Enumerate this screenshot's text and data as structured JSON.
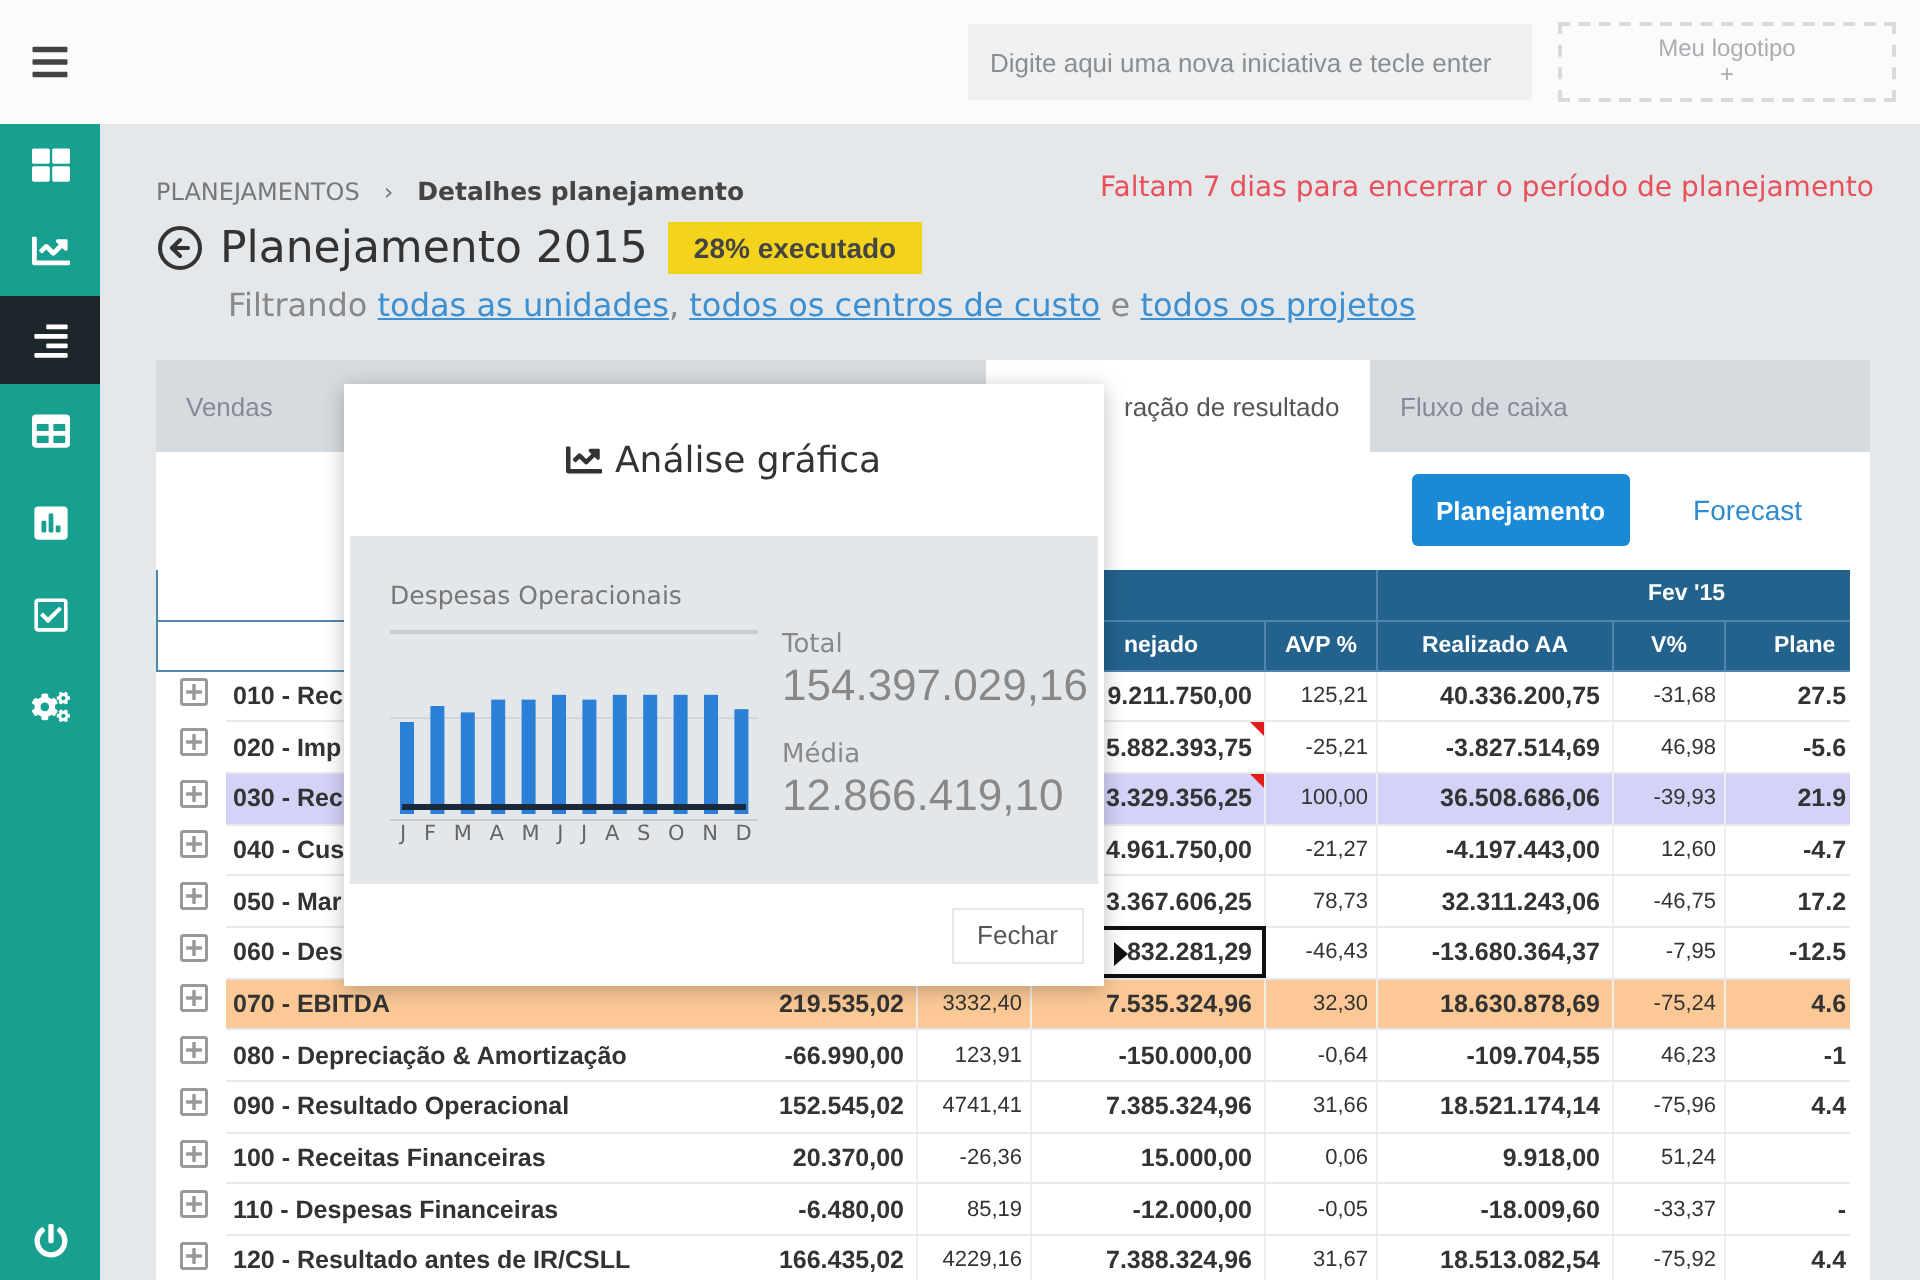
{
  "topbar": {
    "search": {
      "placeholder": "Digite aqui uma nova iniciativa e tecle enter"
    },
    "logo": {
      "label": "Meu logotipo",
      "plus": "+"
    }
  },
  "sidebar": {
    "items": [
      {
        "selected": false
      },
      {
        "selected": false
      },
      {
        "selected": true
      },
      {
        "selected": false
      },
      {
        "selected": false
      },
      {
        "selected": false
      },
      {
        "selected": false
      }
    ]
  },
  "breadcrumb": {
    "items": [
      "PLANEJAMENTOS",
      "Detalhes planejamento"
    ],
    "separator": "›"
  },
  "notice": "Faltam 7 dias para encerrar o período de planejamento",
  "title": "Planejamento 2015",
  "badge": "28% executado",
  "filter": [
    {
      "kind": "text",
      "text": "Filtrando "
    },
    {
      "kind": "link",
      "text": "todas as unidades"
    },
    {
      "kind": "text",
      "text": ", "
    },
    {
      "kind": "link",
      "text": "todos os centros de custo"
    },
    {
      "kind": "text",
      "text": " e "
    },
    {
      "kind": "link",
      "text": "todos os projetos"
    }
  ],
  "tabs": [
    {
      "label": "Vendas",
      "selected": false
    },
    {
      "label": "ração de resultado",
      "selected": true
    },
    {
      "label": "Fluxo de caixa",
      "selected": false
    }
  ],
  "view_buttons": [
    {
      "label": "Planejamento",
      "selected": true
    },
    {
      "label": "Forecast",
      "selected": false
    }
  ],
  "table": {
    "group_headers": [
      "Fev '15"
    ],
    "columns": [
      "nejado",
      "AVP %",
      "Realizado AA",
      "V%",
      "Plane"
    ],
    "rows": [
      {
        "label": "010 - Rec",
        "covered": true,
        "flagged": false,
        "focused": false,
        "cells": [
          "9.211.750,00",
          "125,21",
          "40.336.200,75",
          "-31,68",
          "27.5"
        ]
      },
      {
        "label": "020 - Imp",
        "covered": true,
        "flagged": true,
        "focused": false,
        "cells": [
          "5.882.393,75",
          "-25,21",
          "-3.827.514,69",
          "46,98",
          "-5.6"
        ]
      },
      {
        "label": "030 - Rec",
        "covered": true,
        "flagged": true,
        "focused": false,
        "color": "#d3d2f7",
        "cells": [
          "3.329.356,25",
          "100,00",
          "36.508.686,06",
          "-39,93",
          "21.9"
        ]
      },
      {
        "label": "040 - Cus",
        "covered": true,
        "flagged": false,
        "focused": false,
        "cells": [
          "4.961.750,00",
          "-21,27",
          "-4.197.443,00",
          "12,60",
          "-4.7"
        ]
      },
      {
        "label": "050 - Mar",
        "covered": true,
        "flagged": false,
        "focused": false,
        "cells": [
          "3.367.606,25",
          "78,73",
          "32.311.243,06",
          "-46,75",
          "17.2"
        ]
      },
      {
        "label": "060 - Des",
        "covered": true,
        "flagged": false,
        "focused": true,
        "cells": [
          "832.281,29",
          "-46,43",
          "-13.680.364,37",
          "-7,95",
          "-12.5"
        ]
      },
      {
        "label": "070 - EBITDA",
        "covered": false,
        "flagged": false,
        "focused": false,
        "color": "#fcc996",
        "cells": [
          "219.535,02",
          "3332,40",
          "7.535.324,96",
          "32,30",
          "18.630.878,69",
          "-75,24",
          "4.6"
        ]
      },
      {
        "label": "080 - Depreciação & Amortização",
        "covered": false,
        "flagged": false,
        "focused": false,
        "cells": [
          "-66.990,00",
          "123,91",
          "-150.000,00",
          "-0,64",
          "-109.704,55",
          "46,23",
          "-1"
        ]
      },
      {
        "label": "090 - Resultado Operacional",
        "covered": false,
        "flagged": false,
        "focused": false,
        "cells": [
          "152.545,02",
          "4741,41",
          "7.385.324,96",
          "31,66",
          "18.521.174,14",
          "-75,96",
          "4.4"
        ]
      },
      {
        "label": "100 - Receitas Financeiras",
        "covered": false,
        "flagged": false,
        "focused": false,
        "cells": [
          "20.370,00",
          "-26,36",
          "15.000,00",
          "0,06",
          "9.918,00",
          "51,24"
        ]
      },
      {
        "label": "110 - Despesas Financeiras",
        "covered": false,
        "flagged": false,
        "focused": false,
        "cells": [
          "-6.480,00",
          "85,19",
          "-12.000,00",
          "-0,05",
          "-18.009,60",
          "-33,37",
          "-"
        ]
      },
      {
        "label": "120 - Resultado antes de IR/CSLL",
        "covered": false,
        "flagged": false,
        "focused": false,
        "cells": [
          "166.435,02",
          "4229,16",
          "7.388.324,96",
          "31,67",
          "18.513.082,54",
          "-75,92",
          "4.4"
        ]
      }
    ]
  },
  "modal": {
    "title": "Análise gráfica",
    "chart_title": "Despesas Operacionais",
    "months": [
      "J",
      "F",
      "M",
      "A",
      "M",
      "J",
      "J",
      "A",
      "S",
      "O",
      "N",
      "D"
    ],
    "total_label": "Total",
    "total": "154.397.029,16",
    "average_label": "Média",
    "average": "12.866.419,10",
    "close": "Fechar"
  }
}
